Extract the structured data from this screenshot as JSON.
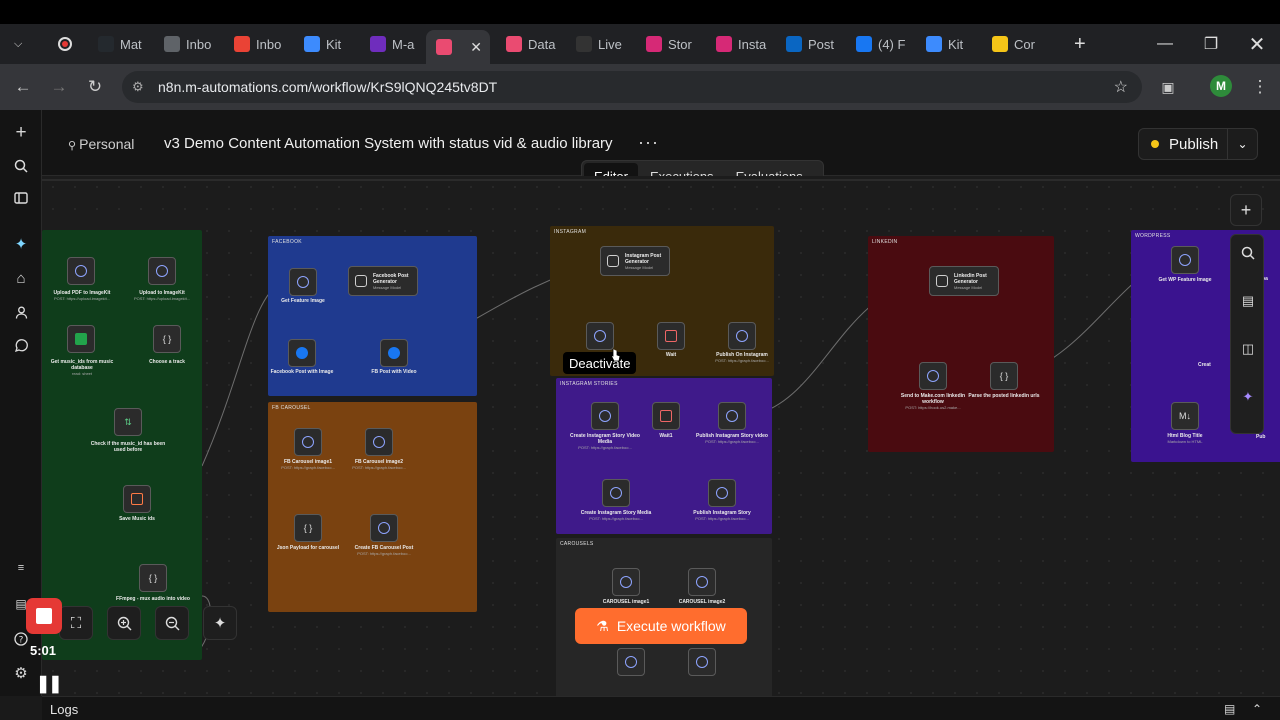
{
  "browser": {
    "tabs": [
      {
        "label": "Mat",
        "icon": "github-icon",
        "color": "#24292e"
      },
      {
        "label": "Inbo",
        "icon": "mail-icon",
        "color": "#5f6368"
      },
      {
        "label": "Inbo",
        "icon": "gmail-icon",
        "color": "#ea4335"
      },
      {
        "label": "Kit",
        "icon": "kit-icon",
        "color": "#3d8bfd"
      },
      {
        "label": "M-a",
        "icon": "make-icon",
        "color": "#6f2dbd"
      },
      {
        "label": "",
        "icon": "n8n-icon",
        "color": "#ea4b71",
        "active": true
      },
      {
        "label": "Data",
        "icon": "n8n-icon",
        "color": "#ea4b71"
      },
      {
        "label": "Live",
        "icon": "live-icon",
        "color": "#333333"
      },
      {
        "label": "Stor",
        "icon": "instagram-icon",
        "color": "#d62976"
      },
      {
        "label": "Insta",
        "icon": "instagram-icon",
        "color": "#d62976"
      },
      {
        "label": "Post",
        "icon": "linkedin-icon",
        "color": "#0a66c2"
      },
      {
        "label": "(4) F",
        "icon": "facebook-icon",
        "color": "#1877f2"
      },
      {
        "label": "Kit",
        "icon": "kit-icon",
        "color": "#3d8bfd"
      },
      {
        "label": "Cor",
        "icon": "coinbase-icon",
        "color": "#f5c518"
      }
    ],
    "url": "n8n.m-automations.com/workflow/KrS9lQNQ245tv8DT",
    "avatar_letter": "M"
  },
  "header": {
    "project": "Personal",
    "workflow_name": "v3 Demo Content Automation System with status vid & audio library",
    "publish_label": "Publish",
    "view_tabs": [
      "Editor",
      "Executions",
      "Evaluations"
    ],
    "active_view": "Editor"
  },
  "canvas": {
    "stickies": [
      {
        "title": "FACEBOOK",
        "color": "#1f3a8f"
      },
      {
        "title": "FB CAROUSEL",
        "color": "#7a4210"
      },
      {
        "title": "INSTAGRAM",
        "color": "#3a2a0b"
      },
      {
        "title": "INSTAGRAM STORIES",
        "color": "#3f1a8a"
      },
      {
        "title": "CAROUSELS",
        "color": "#262626"
      },
      {
        "title": "LINKEDIN",
        "color": "#4a0b10"
      },
      {
        "title": "WORDPRESS",
        "color": "#3a138f"
      }
    ],
    "nodes": {
      "upload_pdf": {
        "label": "Upload PDF to ImageKit",
        "sub": "POST: https://upload.imagekit..."
      },
      "upload_imagekit": {
        "label": "Upload to ImageKit",
        "sub": "POST: https://upload.imagekit..."
      },
      "get_music": {
        "label": "Get music_ids from music database",
        "sub": "read: sheet"
      },
      "choose_track": {
        "label": "Choose a track"
      },
      "check_music": {
        "label": "Check if the music_id has been used before"
      },
      "save_music": {
        "label": "Save Music ids"
      },
      "ffmpeg": {
        "label": "FFmpeg - mux audio into video"
      },
      "get_feature": {
        "label": "Get Feature Image"
      },
      "fb_generator": {
        "label": "Facebook Post Generator",
        "sub": "Message Model"
      },
      "fb_post_image": {
        "label": "Facebook Post with Image"
      },
      "fb_post_video": {
        "label": "FB Post with Video"
      },
      "fb_car1": {
        "label": "FB Carousel image1",
        "sub": "POST: https://graph.faceboo..."
      },
      "fb_car2": {
        "label": "FB Carousel image2",
        "sub": "POST: https://graph.faceboo..."
      },
      "json_payload": {
        "label": "Json Payload for carousel"
      },
      "create_fb_car": {
        "label": "Create FB Carousel Post",
        "sub": "POST: https://graph.faceboo..."
      },
      "ig_generator": {
        "label": "Instagram Post Generator",
        "sub": "Message Model"
      },
      "wait": {
        "label": "Wait"
      },
      "publish_ig": {
        "label": "Publish On Instagram",
        "sub": "POST: https://graph.faceboo..."
      },
      "create_story_video": {
        "label": "Create Instagram Story Video Media",
        "sub": "POST: https://graph.faceboo..."
      },
      "wait1": {
        "label": "Wait1"
      },
      "publish_story_video": {
        "label": "Publish Instagram Story video",
        "sub": "POST: https://graph.faceboo..."
      },
      "create_story_media": {
        "label": "Create Instagram Story Media",
        "sub": "POST: https://graph.faceboo..."
      },
      "publish_story": {
        "label": "Publish Instagram Story",
        "sub": "POST: https://graph.faceboo..."
      },
      "car_image1": {
        "label": "CAROUSEL image1"
      },
      "car_image2": {
        "label": "CAROUSEL image2"
      },
      "li_generator": {
        "label": "Linkedin Post Generator",
        "sub": "Message Model"
      },
      "send_make": {
        "label": "Send to Make.com linkedin workflow",
        "sub": "POST: https://hook.us2.make..."
      },
      "parse_li": {
        "label": "Parse the posted linkedin urls"
      },
      "get_wp": {
        "label": "Get WP Feature Image"
      },
      "html_blog": {
        "label": "Html Blog Title",
        "sub": "Markdown to HTML"
      },
      "create_wp": {
        "label": "Creat"
      },
      "upload_wp": {
        "label": "Uploa"
      },
      "publish_wp": {
        "label": "Pub"
      }
    },
    "tooltip": "Deactivate",
    "execute_label": "Execute workflow"
  },
  "recorder": {
    "time": "5:01"
  },
  "logs": {
    "label": "Logs"
  }
}
